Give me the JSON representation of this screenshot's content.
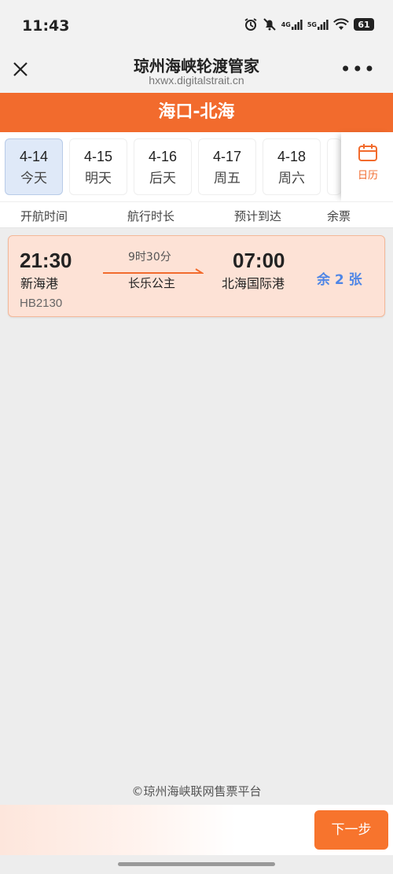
{
  "status": {
    "time": "11:43",
    "net1": "4G",
    "net2": "5G",
    "battery": "61"
  },
  "header": {
    "title": "琼州海峡轮渡管家",
    "url": "hxwx.digitalstrait.cn",
    "more": "•••"
  },
  "route": {
    "title": "海口-北海"
  },
  "dates": [
    {
      "date": "4-14",
      "weekday": "今天"
    },
    {
      "date": "4-15",
      "weekday": "明天"
    },
    {
      "date": "4-16",
      "weekday": "后天"
    },
    {
      "date": "4-17",
      "weekday": "周五"
    },
    {
      "date": "4-18",
      "weekday": "周六"
    }
  ],
  "calendar_label": "日历",
  "columns": {
    "depart": "开航时间",
    "duration": "航行时长",
    "arrive": "预计到达",
    "tickets": "余票"
  },
  "voyage": {
    "depart_time": "21:30",
    "depart_port": "新海港",
    "duration": "9时30分",
    "ship": "长乐公主",
    "arrive_time": "07:00",
    "arrive_port": "北海国际港",
    "tickets": "余 2 张",
    "voyage_no": "HB2130"
  },
  "footer": "©琼州海峡联网售票平台",
  "next_button": "下一步",
  "colors": {
    "accent": "#f26b2d",
    "selected_date": "#dfe9f8",
    "ticket_blue": "#4f86e6",
    "card_bg": "#fde2d6"
  }
}
